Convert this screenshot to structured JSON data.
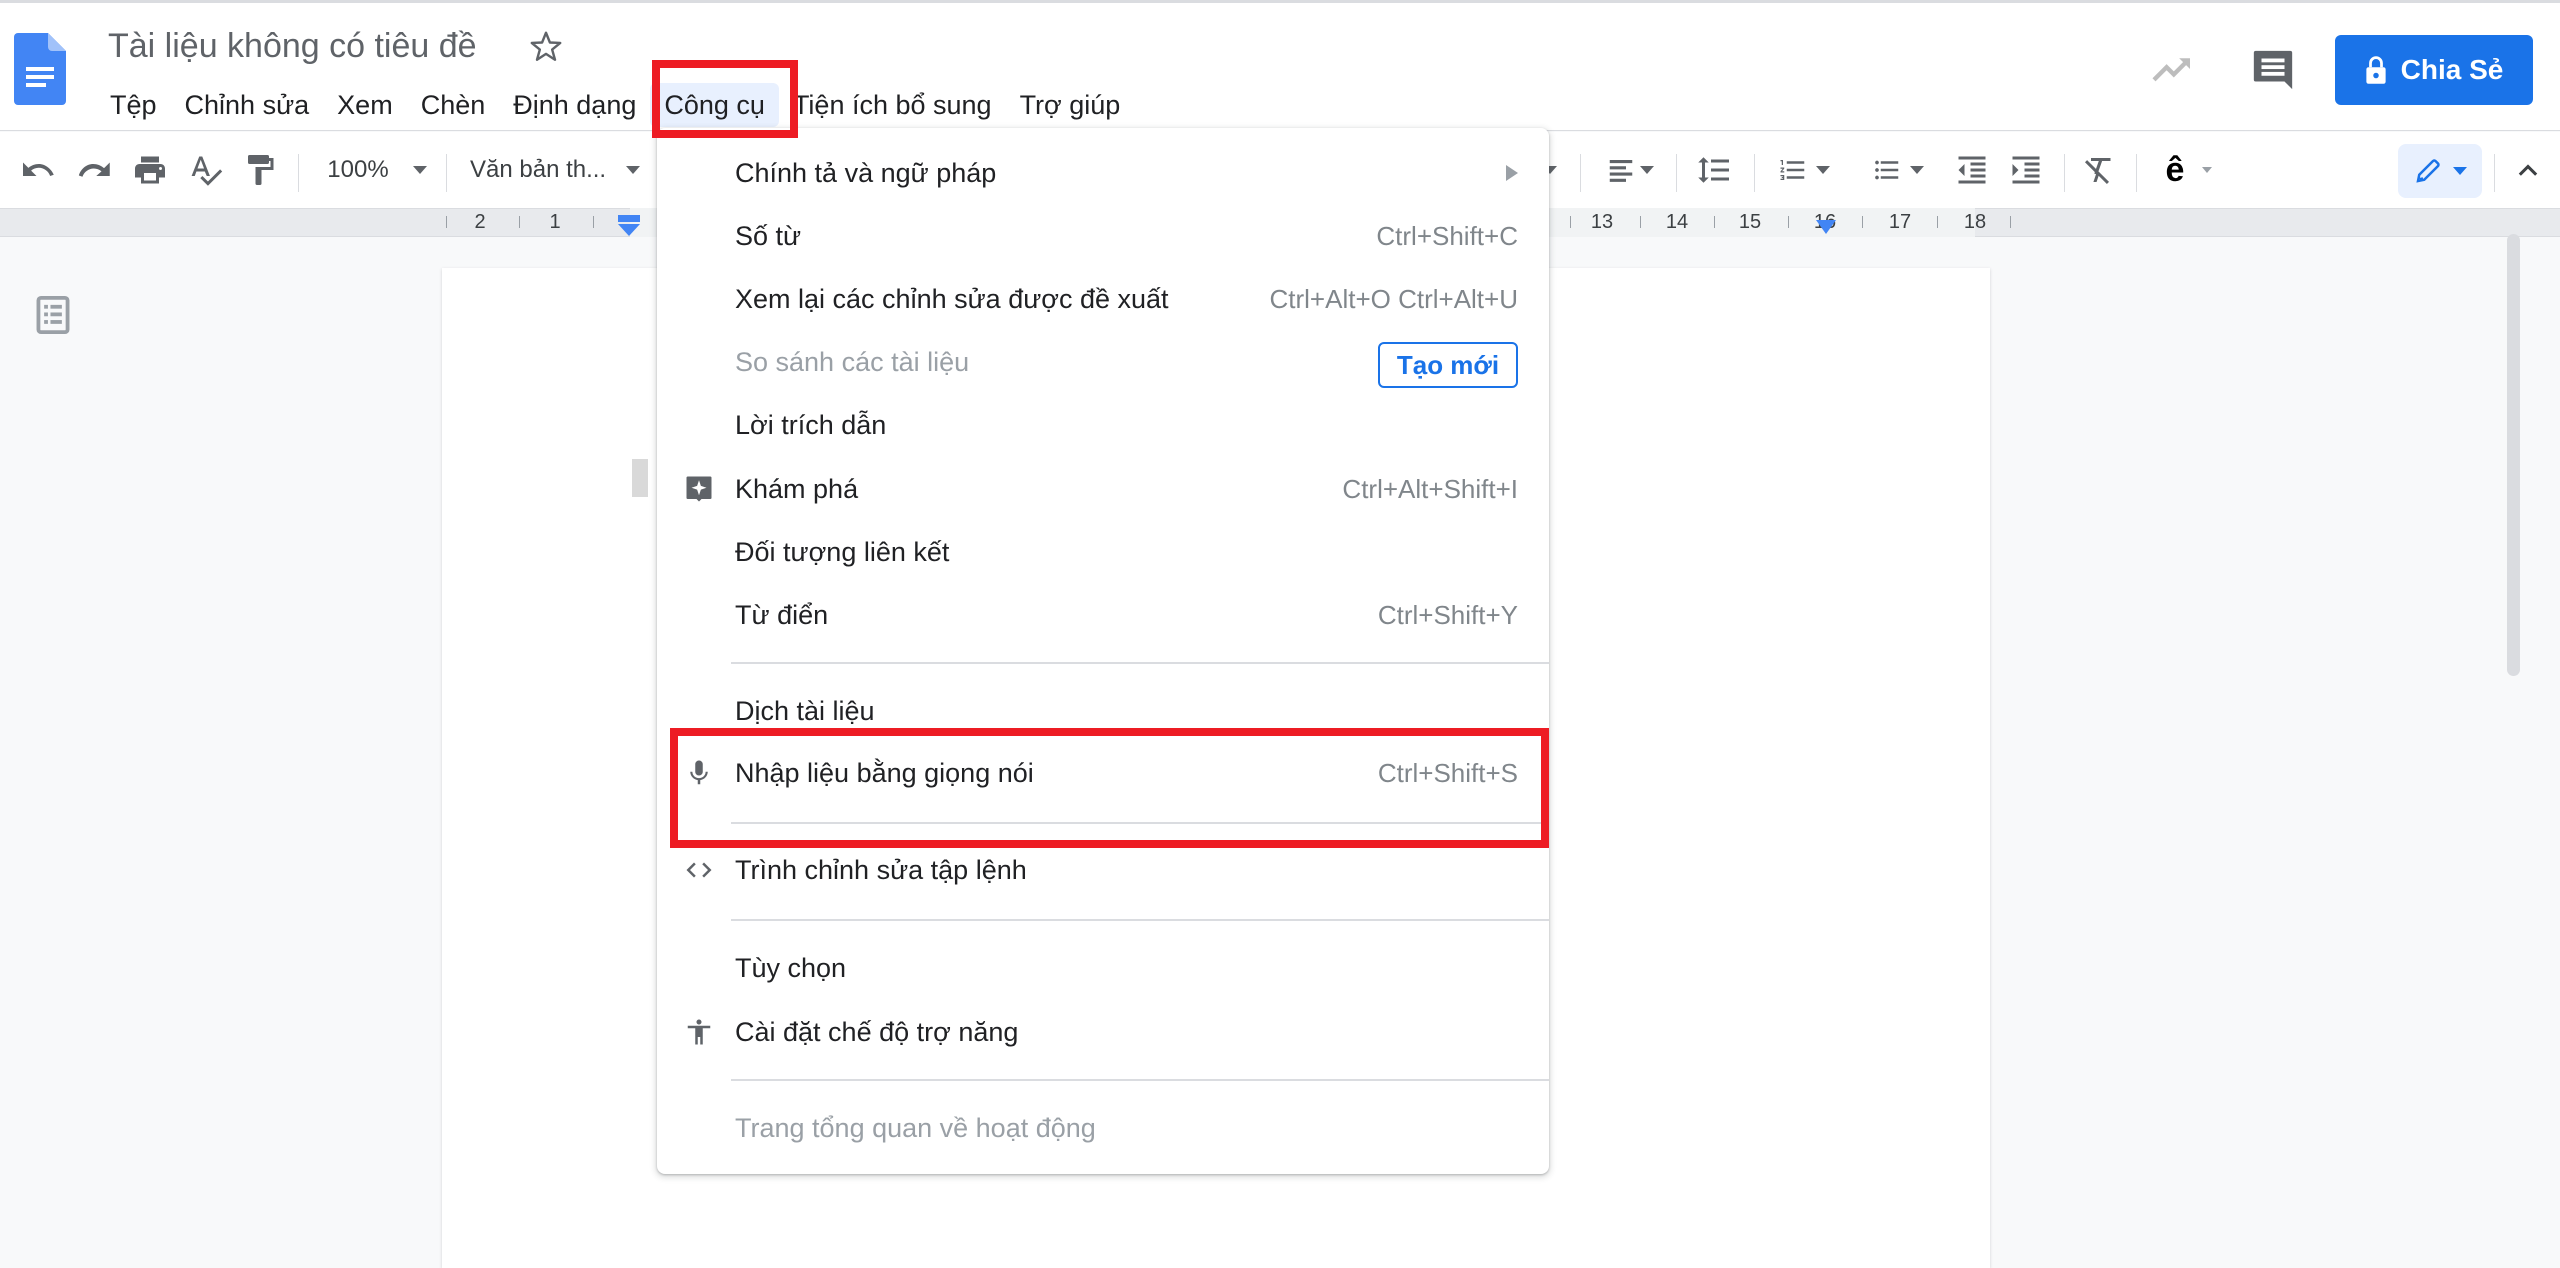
{
  "header": {
    "doc_title": "Tài liệu không có tiêu đề",
    "menu": [
      "Tệp",
      "Chỉnh sửa",
      "Xem",
      "Chèn",
      "Định dạng",
      "Công cụ",
      "Tiện ích bổ sung",
      "Trợ giúp"
    ],
    "active_menu": "Công cụ",
    "share_label": "Chia Sẻ",
    "colors": {
      "accent": "#1a73e8",
      "highlight": "#ed1c24"
    }
  },
  "toolbar": {
    "zoom": "100%",
    "style": "Văn bản th...",
    "input_tool_glyph": "ê"
  },
  "ruler": {
    "left_numbers": [
      "2",
      "1"
    ],
    "right_numbers": [
      "13",
      "14",
      "15",
      "16",
      "17",
      "18"
    ]
  },
  "tools_menu": {
    "items": [
      {
        "label": "Chính tả và ngữ pháp",
        "shortcut": "",
        "icon": "",
        "submenu": true
      },
      {
        "label": "Số từ",
        "shortcut": "Ctrl+Shift+C",
        "icon": ""
      },
      {
        "label": "Xem lại các chỉnh sửa được đề xuất",
        "shortcut": "Ctrl+Alt+O Ctrl+Alt+U",
        "icon": ""
      },
      {
        "label": "So sánh các tài liệu",
        "shortcut": "",
        "icon": "",
        "disabled": true,
        "badge": "Tạo mới"
      },
      {
        "label": "Lời trích dẫn",
        "shortcut": "",
        "icon": ""
      },
      {
        "label": "Khám phá",
        "shortcut": "Ctrl+Alt+Shift+I",
        "icon": "explore-icon"
      },
      {
        "label": "Đối tượng liên kết",
        "shortcut": "",
        "icon": ""
      },
      {
        "label": "Từ điển",
        "shortcut": "Ctrl+Shift+Y",
        "icon": ""
      },
      {
        "label": "Dịch tài liệu",
        "shortcut": "",
        "icon": ""
      },
      {
        "label": "Nhập liệu bằng giọng nói",
        "shortcut": "Ctrl+Shift+S",
        "icon": "microphone-icon",
        "highlighted": true
      },
      {
        "label": "Trình chỉnh sửa tập lệnh",
        "shortcut": "",
        "icon": "code-icon"
      },
      {
        "label": "Tùy chọn",
        "shortcut": "",
        "icon": ""
      },
      {
        "label": "Cài đặt chế độ trợ năng",
        "shortcut": "",
        "icon": "accessibility-icon"
      },
      {
        "label": "Trang tổng quan về hoạt động",
        "shortcut": "",
        "icon": "",
        "disabled": true
      }
    ]
  }
}
